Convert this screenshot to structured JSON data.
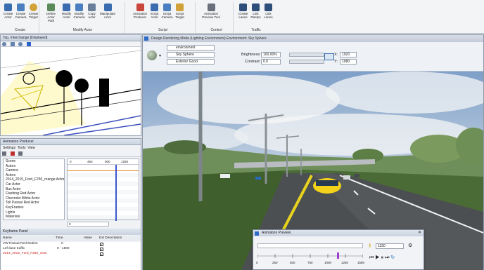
{
  "ribbon": {
    "groups": [
      {
        "title": "Create",
        "buttons": [
          "Create Actor",
          "Create Camera",
          "Create Target"
        ]
      },
      {
        "title": "Modify Actor",
        "buttons": [
          "Define Actor Path",
          "Modify Actor",
          "Modify Camera",
          "Copy Actor",
          "Manipulate Actor"
        ]
      },
      {
        "title": "Script",
        "buttons": [
          "Animation Producer",
          "Script Actor",
          "Script Camera",
          "Script Target"
        ]
      },
      {
        "title": "Control",
        "buttons": [
          "Animation Preview Tool"
        ]
      },
      {
        "title": "Traffic",
        "buttons": [
          "Create Lanes",
          "Link Ramps",
          "Link Lanes"
        ]
      }
    ]
  },
  "topview": {
    "title": "Top, Interchange [Displayed]"
  },
  "producer": {
    "title": "Animation Producer",
    "menu": [
      "Settings",
      "Tools",
      "View"
    ],
    "tree_items": [
      "Scene",
      "Actors",
      "Camera",
      "Actors",
      "2014_2015_Ford_F250_orange Actor",
      "Car Actor",
      "Bus Actor",
      "Flashing Red Actor",
      "Chevrolet White Actor",
      "Toll Passat Red Actor",
      "KeyFrames",
      "Lights",
      "Materials"
    ],
    "timeline_ticks": [
      "0",
      "450",
      "900",
      "1250"
    ],
    "frame_value": "0",
    "bottom_title": "Keyframe Panel",
    "columns": [
      "Name",
      "Time",
      "Value",
      "Ext Description"
    ],
    "rows": [
      {
        "name": "VW Passat Red Motion",
        "time": "0",
        "value": "",
        "ext": "checked"
      },
      {
        "name": "Left lane traffic",
        "time": "0 - 1500",
        "value": "",
        "ext": "checked"
      },
      {
        "name": "2014_2015_Ford_F250_oran",
        "time": "",
        "value": "",
        "ext": "checked"
      }
    ]
  },
  "mainwin": {
    "title": "Design Rendering Mode (Lighting Environment) Environment: Sky Sphere",
    "combo1": "environment",
    "combo2": "Sky Sphere",
    "combo3": "Exterior Good",
    "brightness_label": "Brightness:",
    "brightness_value": "100.00%",
    "contrast_label": "Contrast:",
    "contrast_value": "0.0",
    "x_label": "X:",
    "x_value": "1920",
    "y_label": "Y:",
    "y_value": "1080"
  },
  "anim_preview": {
    "title": "Animation Preview",
    "frame": "1150",
    "ticks": [
      "0",
      "250",
      "500",
      "750",
      "1000",
      "1250",
      "1500"
    ]
  }
}
